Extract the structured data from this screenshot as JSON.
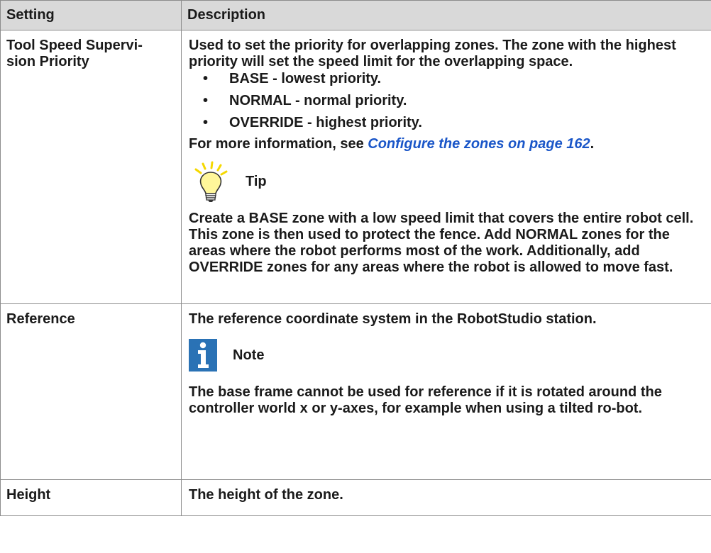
{
  "header": {
    "setting": "Setting",
    "description": "Description"
  },
  "rows": [
    {
      "setting": "Tool Speed Supervi-\nsion Priority",
      "para1": "Used to set the priority for overlapping zones. The zone with the highest priority will set the speed limit for the overlapping space.",
      "bullets": [
        {
          "term": "BASE",
          "text": " - lowest priority."
        },
        {
          "term": "NORMAL",
          "text": " - normal priority."
        },
        {
          "term": "OVERRIDE",
          "text": " - highest priority."
        }
      ],
      "more_info_prefix": "For more information, see ",
      "more_info_link": "Configure the zones on page 162",
      "more_info_suffix": ".",
      "tip_label": "Tip",
      "tip_text_parts": [
        "Create a ",
        "BASE",
        " zone with a low speed limit that covers the entire robot cell. This zone is then used to protect the fence. Add ",
        "NORMAL",
        " zones for the areas where the robot performs most of the work. Additionally, add ",
        "OVERRIDE",
        " zones for any areas where the robot is allowed to move fast."
      ],
      "tip_icon": "lightbulb-icon"
    },
    {
      "setting": "Reference",
      "para1": "The reference coordinate system in the RobotStudio station.",
      "note_label": "Note",
      "note_text": "The base frame cannot be used for reference if it is rotated around the controller world x or y-axes, for example when using a tilted ro-bot.",
      "note_icon": "info-icon"
    },
    {
      "setting": "Height",
      "para1": "The height of the zone."
    }
  ],
  "colors": {
    "header_bg": "#d9d9d9",
    "border": "#8c8c8c",
    "link": "#1a56c8",
    "note_icon": "#2a72b5",
    "tip_bulb": "#f5e400"
  }
}
